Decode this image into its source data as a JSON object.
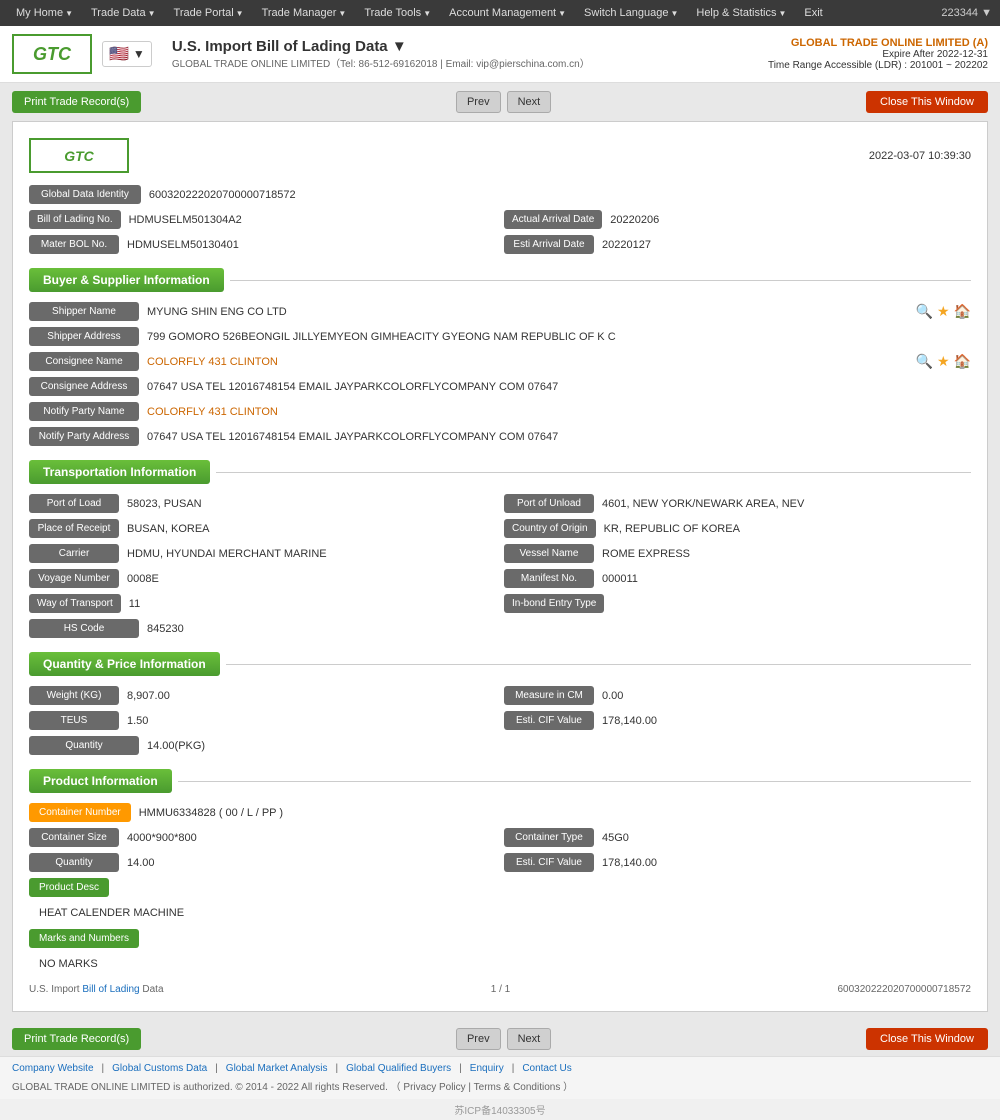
{
  "topnav": {
    "user_id": "223344 ▼",
    "items": [
      {
        "label": "My Home",
        "arrow": true
      },
      {
        "label": "Trade Data",
        "arrow": true
      },
      {
        "label": "Trade Portal",
        "arrow": true
      },
      {
        "label": "Trade Manager",
        "arrow": true
      },
      {
        "label": "Trade Tools",
        "arrow": true
      },
      {
        "label": "Account Management",
        "arrow": true
      },
      {
        "label": "Switch Language",
        "arrow": true
      },
      {
        "label": "Help & Statistics",
        "arrow": true
      },
      {
        "label": "Exit",
        "arrow": false
      }
    ]
  },
  "header": {
    "logo_text": "GTC",
    "flag_emoji": "🇺🇸",
    "page_title": "U.S. Import Bill of Lading Data ▼",
    "company_info": "GLOBAL TRADE ONLINE LIMITED（Tel: 86-512-69162018 | Email: vip@pierschina.com.cn）",
    "company_name": "GLOBAL TRADE ONLINE LIMITED (A)",
    "expire_label": "Expire After 2022-12-31",
    "time_range": "Time Range Accessible (LDR) : 201001 ~ 202202"
  },
  "toolbar": {
    "print_label": "Print Trade Record(s)",
    "prev_label": "Prev",
    "next_label": "Next",
    "close_label": "Close This Window"
  },
  "card": {
    "logo_text": "GTC",
    "timestamp": "2022-03-07 10:39:30",
    "global_data_label": "Global Data Identity",
    "global_data_value": "600320222020700000718572",
    "bol_label": "Bill of Lading No.",
    "bol_value": "HDMUSELM501304A2",
    "actual_arrival_label": "Actual Arrival Date",
    "actual_arrival_value": "20220206",
    "mater_bol_label": "Mater BOL No.",
    "mater_bol_value": "HDMUSELM50130401",
    "esti_arrival_label": "Esti Arrival Date",
    "esti_arrival_value": "20220127"
  },
  "buyer_supplier": {
    "section_title": "Buyer & Supplier Information",
    "shipper_name_label": "Shipper Name",
    "shipper_name_value": "MYUNG SHIN ENG CO LTD",
    "shipper_address_label": "Shipper Address",
    "shipper_address_value": "799 GOMORO 526BEONGIL JILLYEMYEON GIMHEACITY GYEONG NAM REPUBLIC OF K C",
    "consignee_name_label": "Consignee Name",
    "consignee_name_value": "COLORFLY 431 CLINTON",
    "consignee_address_label": "Consignee Address",
    "consignee_address_value": "07647 USA TEL 12016748154 EMAIL JAYPARKCOLORFLYCOMPANY COM 07647",
    "notify_party_name_label": "Notify Party Name",
    "notify_party_name_value": "COLORFLY 431 CLINTON",
    "notify_party_address_label": "Notify Party Address",
    "notify_party_address_value": "07647 USA TEL 12016748154 EMAIL JAYPARKCOLORFLYCOMPANY COM 07647"
  },
  "transportation": {
    "section_title": "Transportation Information",
    "port_of_load_label": "Port of Load",
    "port_of_load_value": "58023, PUSAN",
    "port_of_unload_label": "Port of Unload",
    "port_of_unload_value": "4601, NEW YORK/NEWARK AREA, NEV",
    "place_of_receipt_label": "Place of Receipt",
    "place_of_receipt_value": "BUSAN, KOREA",
    "country_of_origin_label": "Country of Origin",
    "country_of_origin_value": "KR, REPUBLIC OF KOREA",
    "carrier_label": "Carrier",
    "carrier_value": "HDMU, HYUNDAI MERCHANT MARINE",
    "vessel_name_label": "Vessel Name",
    "vessel_name_value": "ROME EXPRESS",
    "voyage_number_label": "Voyage Number",
    "voyage_number_value": "0008E",
    "manifest_no_label": "Manifest No.",
    "manifest_no_value": "000011",
    "way_of_transport_label": "Way of Transport",
    "way_of_transport_value": "11",
    "in_bond_label": "In-bond Entry Type",
    "in_bond_value": "",
    "hs_code_label": "HS Code",
    "hs_code_value": "845230"
  },
  "quantity_price": {
    "section_title": "Quantity & Price Information",
    "weight_label": "Weight (KG)",
    "weight_value": "8,907.00",
    "measure_label": "Measure in CM",
    "measure_value": "0.00",
    "teus_label": "TEUS",
    "teus_value": "1.50",
    "esti_cif_label": "Esti. CIF Value",
    "esti_cif_value": "178,140.00",
    "quantity_label": "Quantity",
    "quantity_value": "14.00(PKG)"
  },
  "product": {
    "section_title": "Product Information",
    "container_num_label": "Container Number",
    "container_num_value": "HMMU6334828 ( 00 / L / PP )",
    "container_size_label": "Container Size",
    "container_size_value": "4000*900*800",
    "container_type_label": "Container Type",
    "container_type_value": "45G0",
    "quantity_label": "Quantity",
    "quantity_value": "14.00",
    "esti_cif_label": "Esti. CIF Value",
    "esti_cif_value": "178,140.00",
    "product_desc_label": "Product Desc",
    "product_desc_value": "HEAT CALENDER MACHINE",
    "marks_label": "Marks and Numbers",
    "marks_value": "NO MARKS"
  },
  "card_footer": {
    "doc_type": "U.S. Import Bill of Lading Data",
    "page_info": "1 / 1",
    "record_id": "600320222020700000718572"
  },
  "site_footer": {
    "links": [
      "Company Website",
      "Global Customs Data",
      "Global Market Analysis",
      "Global Qualified Buyers",
      "Enquiry",
      "Contact Us"
    ],
    "copyright": "GLOBAL TRADE ONLINE LIMITED is authorized. © 2014 - 2022 All rights Reserved.  （ Privacy Policy | Terms & Conditions ）",
    "icp": "苏ICP备14033305号"
  }
}
